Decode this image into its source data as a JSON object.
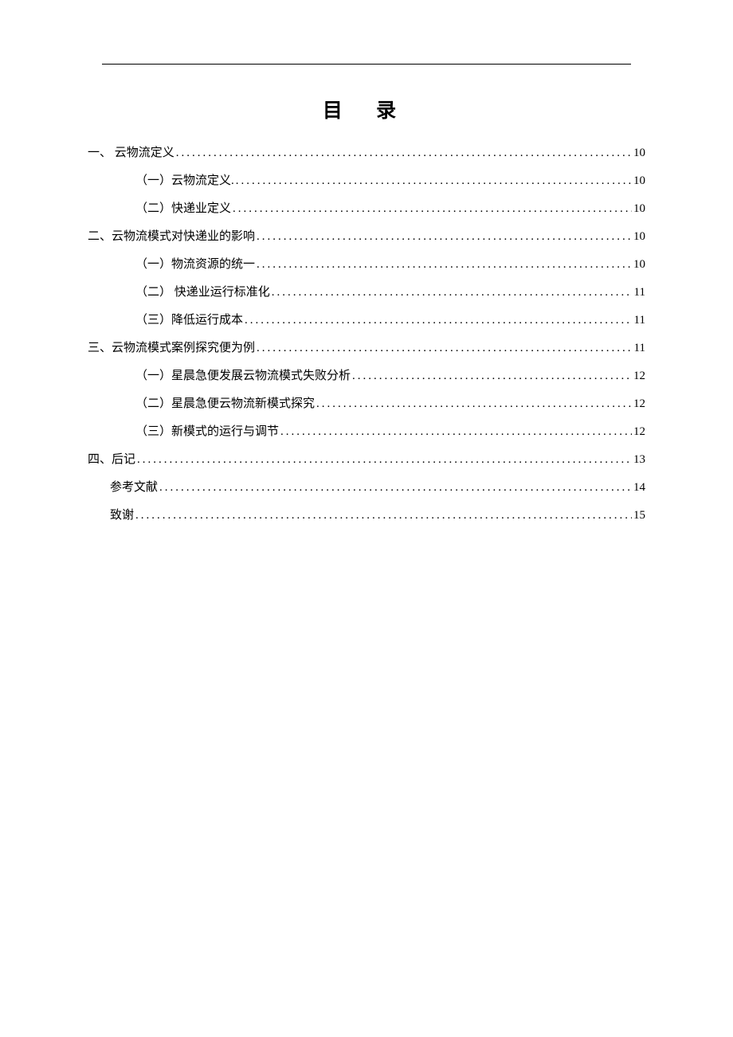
{
  "title": "目 录",
  "toc": [
    {
      "level": "level-1",
      "label": "一、 云物流定义 ",
      "page": "10"
    },
    {
      "level": "level-2",
      "label": "（一）云物流定义.",
      "page": "10"
    },
    {
      "level": "level-2",
      "label": "（二）快递业定义",
      "page": "10"
    },
    {
      "level": "level-1",
      "label": "二、云物流模式对快递业的影响 ",
      "page": "10"
    },
    {
      "level": "level-2",
      "label": "（一）物流资源的统一",
      "page": "10"
    },
    {
      "level": "level-2",
      "label": "（二） 快递业运行标准化 ",
      "page": "11"
    },
    {
      "level": "level-2",
      "label": "（三）降低运行成本",
      "page": "11"
    },
    {
      "level": "level-1",
      "label": "三、云物流模式案例探究便为例 ",
      "page": "11"
    },
    {
      "level": "level-2",
      "label": "（一）星晨急便发展云物流模式失败分析",
      "page": "12"
    },
    {
      "level": "level-2",
      "label": "（二）星晨急便云物流新模式探究 ",
      "page": "12"
    },
    {
      "level": "level-2",
      "label": "（三）新模式的运行与调节",
      "page": "12"
    },
    {
      "level": "level-1",
      "label": "四、后记",
      "page": "13"
    },
    {
      "level": "level-ref",
      "label": "参考文献 ",
      "page": "14"
    },
    {
      "level": "level-ref",
      "label": "致谢 ",
      "page": "15"
    }
  ]
}
